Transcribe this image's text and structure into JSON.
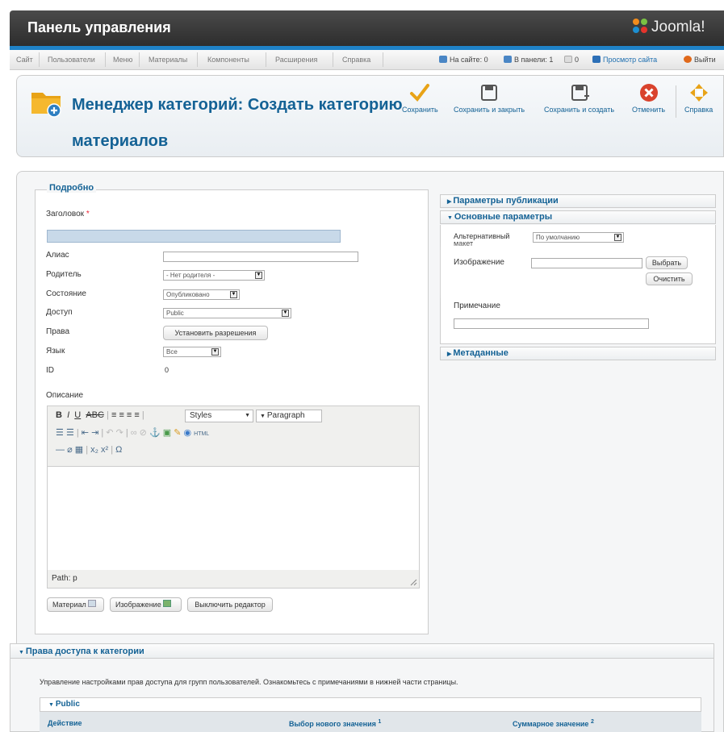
{
  "header": {
    "title": "Панель управления",
    "logo_text": "Joomla!"
  },
  "menu": {
    "items": [
      "Сайт",
      "Пользователи",
      "Меню",
      "Материалы",
      "Компоненты",
      "Расширения",
      "Справка"
    ],
    "status": {
      "on_site": "На сайте: 0",
      "in_panel": "В панели: 1",
      "messages": "0",
      "view_site": "Просмотр сайта",
      "logout": "Выйти"
    }
  },
  "toolbar": {
    "title": "Менеджер категорий: Создать категорию материалов",
    "buttons": {
      "save": "Сохранить",
      "save_close": "Сохранить и закрыть",
      "save_new": "Сохранить и создать",
      "cancel": "Отменить",
      "help": "Справка"
    }
  },
  "details": {
    "legend": "Подробно",
    "title_label": "Заголовок",
    "required_mark": "*",
    "title_value": "",
    "alias_label": "Алиас",
    "alias_value": "",
    "parent_label": "Родитель",
    "parent_value": "- Нет родителя -",
    "state_label": "Состояние",
    "state_value": "Опубликовано",
    "access_label": "Доступ",
    "access_value": "Public",
    "rights_label": "Права",
    "rights_button": "Установить разрешения",
    "language_label": "Язык",
    "language_value": "Все",
    "id_label": "ID",
    "id_value": "0",
    "description_label": "Описание"
  },
  "editor": {
    "styles": "Styles",
    "paragraph": "Paragraph",
    "path": "Path: p",
    "buttons": {
      "article": "Материал",
      "image": "Изображение",
      "toggle": "Выключить редактор"
    }
  },
  "right": {
    "publish_params": "Параметры публикации",
    "basic_params": "Основные параметры",
    "alt_layout_label": "Альтернативный макет",
    "alt_layout_value": "По умолчанию",
    "image_label": "Изображение",
    "image_value": "",
    "select_button": "Выбрать",
    "clear_button": "Очистить",
    "note_label": "Примечание",
    "note_value": "",
    "metadata": "Метаданные"
  },
  "access": {
    "title": "Права доступа к категории",
    "description": "Управление настройками прав доступа для групп пользователей. Ознакомьтесь с примечаниями в нижней части страницы.",
    "group": "Public",
    "col_action": "Действие",
    "col_new": "Выбор нового значения",
    "col_new_sup": "1",
    "col_calc": "Суммарное значение",
    "col_calc_sup": "2"
  },
  "colors": {
    "accent": "#146295",
    "header_bg": "#3a3a3a",
    "blue_line": "#1f82c7",
    "save_check": "#e8a317",
    "cancel_red": "#d9432d"
  }
}
